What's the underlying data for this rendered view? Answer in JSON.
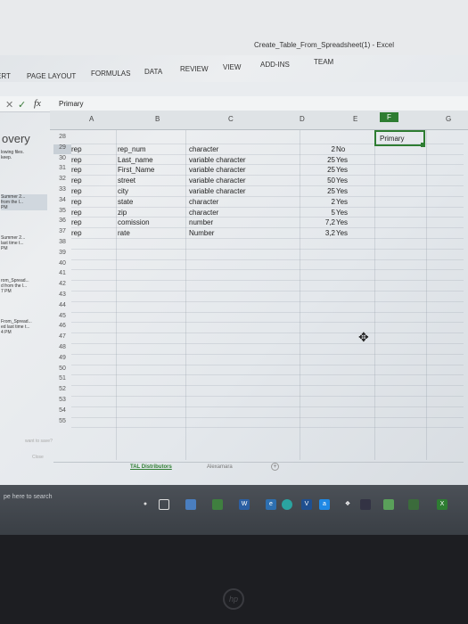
{
  "window": {
    "title": "Create_Table_From_Spreadsheet(1) - Excel"
  },
  "ribbon": {
    "tabs": [
      "ERT",
      "PAGE LAYOUT",
      "FORMULAS",
      "DATA",
      "REVIEW",
      "VIEW",
      "ADD-INS",
      "TEAM"
    ]
  },
  "formula_bar": {
    "fx_label": "fx",
    "value": "Primary"
  },
  "columns": [
    "A",
    "B",
    "C",
    "D",
    "E",
    "F",
    "G"
  ],
  "left_pane": {
    "title": "overy",
    "items": [
      {
        "line1": "lowing files.",
        "line2": "keep."
      },
      {
        "line1": "Summer 2...",
        "line2": "from the l...",
        "line3": "PM"
      },
      {
        "line1": "Summer 2...",
        "line2": "last time t...",
        "line3": "PM"
      },
      {
        "line1": "rom_Spread...",
        "line2": "d from the l...",
        "line3": "7 PM"
      },
      {
        "line1": "From_Spread...",
        "line2": "ed last time t...",
        "line3": "4 PM"
      }
    ],
    "footer_left": "want to save?",
    "footer_close": "Close"
  },
  "rows": [
    {
      "num": "28",
      "a": "",
      "b": "",
      "c": "",
      "d": "",
      "e": ""
    },
    {
      "num": "29",
      "a": "rep",
      "b": "rep_num",
      "c": "character",
      "d": "2",
      "e": "No"
    },
    {
      "num": "30",
      "a": "rep",
      "b": "Last_name",
      "c": "variable character",
      "d": "25",
      "e": "Yes"
    },
    {
      "num": "31",
      "a": "rep",
      "b": "First_Name",
      "c": "variable character",
      "d": "25",
      "e": "Yes"
    },
    {
      "num": "32",
      "a": "rep",
      "b": "street",
      "c": "variable character",
      "d": "50",
      "e": "Yes"
    },
    {
      "num": "33",
      "a": "rep",
      "b": "city",
      "c": "variable character",
      "d": "25",
      "e": "Yes"
    },
    {
      "num": "34",
      "a": "rep",
      "b": "state",
      "c": "character",
      "d": "2",
      "e": "Yes"
    },
    {
      "num": "35",
      "a": "rep",
      "b": "zip",
      "c": "character",
      "d": "5",
      "e": "Yes"
    },
    {
      "num": "36",
      "a": "rep",
      "b": "comission",
      "c": "number",
      "d": "7,2",
      "e": "Yes"
    },
    {
      "num": "37",
      "a": "rep",
      "b": "rate",
      "c": "Number",
      "d": "3,2",
      "e": "Yes"
    },
    {
      "num": "38"
    },
    {
      "num": "39"
    },
    {
      "num": "40"
    },
    {
      "num": "41"
    },
    {
      "num": "42"
    },
    {
      "num": "43"
    },
    {
      "num": "44"
    },
    {
      "num": "45"
    },
    {
      "num": "46"
    },
    {
      "num": "47"
    },
    {
      "num": "48"
    },
    {
      "num": "49"
    },
    {
      "num": "50"
    },
    {
      "num": "51"
    },
    {
      "num": "52"
    },
    {
      "num": "53"
    },
    {
      "num": "54"
    },
    {
      "num": "55"
    }
  ],
  "selected_cell": {
    "value": "Primary"
  },
  "sheet_tabs": [
    "TAL Distributors",
    "Alexamara"
  ],
  "taskbar": {
    "search_placeholder": "pe here to search"
  }
}
